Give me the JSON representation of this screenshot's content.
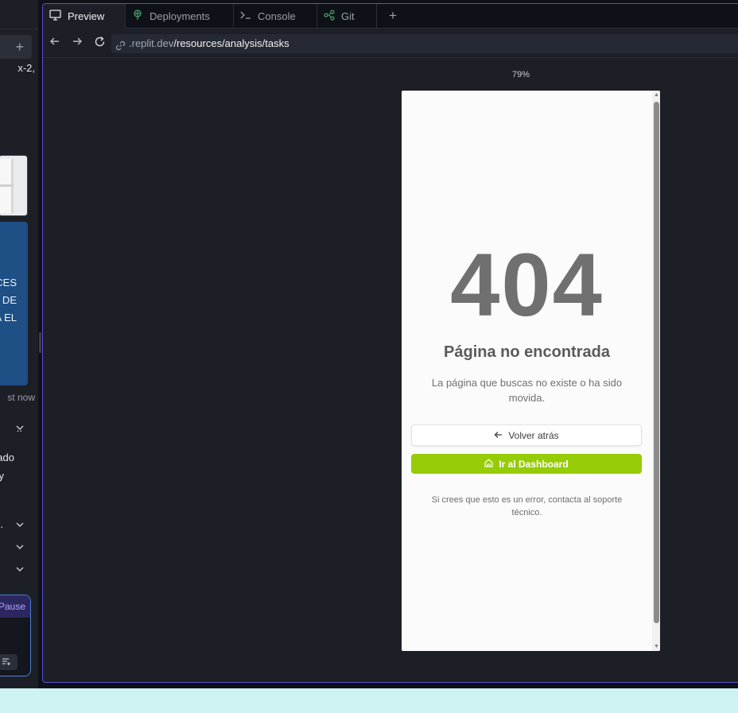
{
  "left_panel": {
    "plus_label": "+",
    "lines": {
      "l1": "x-2,",
      "blue1": "CES",
      "blue2": "O DE",
      "blue3": "A EL",
      "timestamp": "st now",
      "row1": "..",
      "row2a": "ado",
      "row2b": "y",
      "row3": ".",
      "pause": "Pause"
    }
  },
  "tabs": [
    {
      "label": "Preview",
      "icon": "monitor-icon",
      "active": true
    },
    {
      "label": "Deployments",
      "icon": "deployments-icon",
      "active": false
    },
    {
      "label": "Console",
      "icon": "terminal-icon",
      "active": false
    },
    {
      "label": "Git",
      "icon": "git-icon",
      "active": false
    }
  ],
  "tab_add_label": "+",
  "url": {
    "host": ".replit.dev",
    "path": "/resources/analysis/tasks"
  },
  "zoom": "79%",
  "page": {
    "code": "404",
    "title": "Página no encontrada",
    "description": "La página que buscas no existe o ha sido movida.",
    "back_button": "Volver atrás",
    "dashboard_button": "Ir al Dashboard",
    "support_text": "Si crees que esto es un error, contacta al soporte técnico."
  },
  "colors": {
    "accent_green": "#96cc05",
    "pane_border": "#5f4fd1",
    "background": "#1c1f26"
  }
}
